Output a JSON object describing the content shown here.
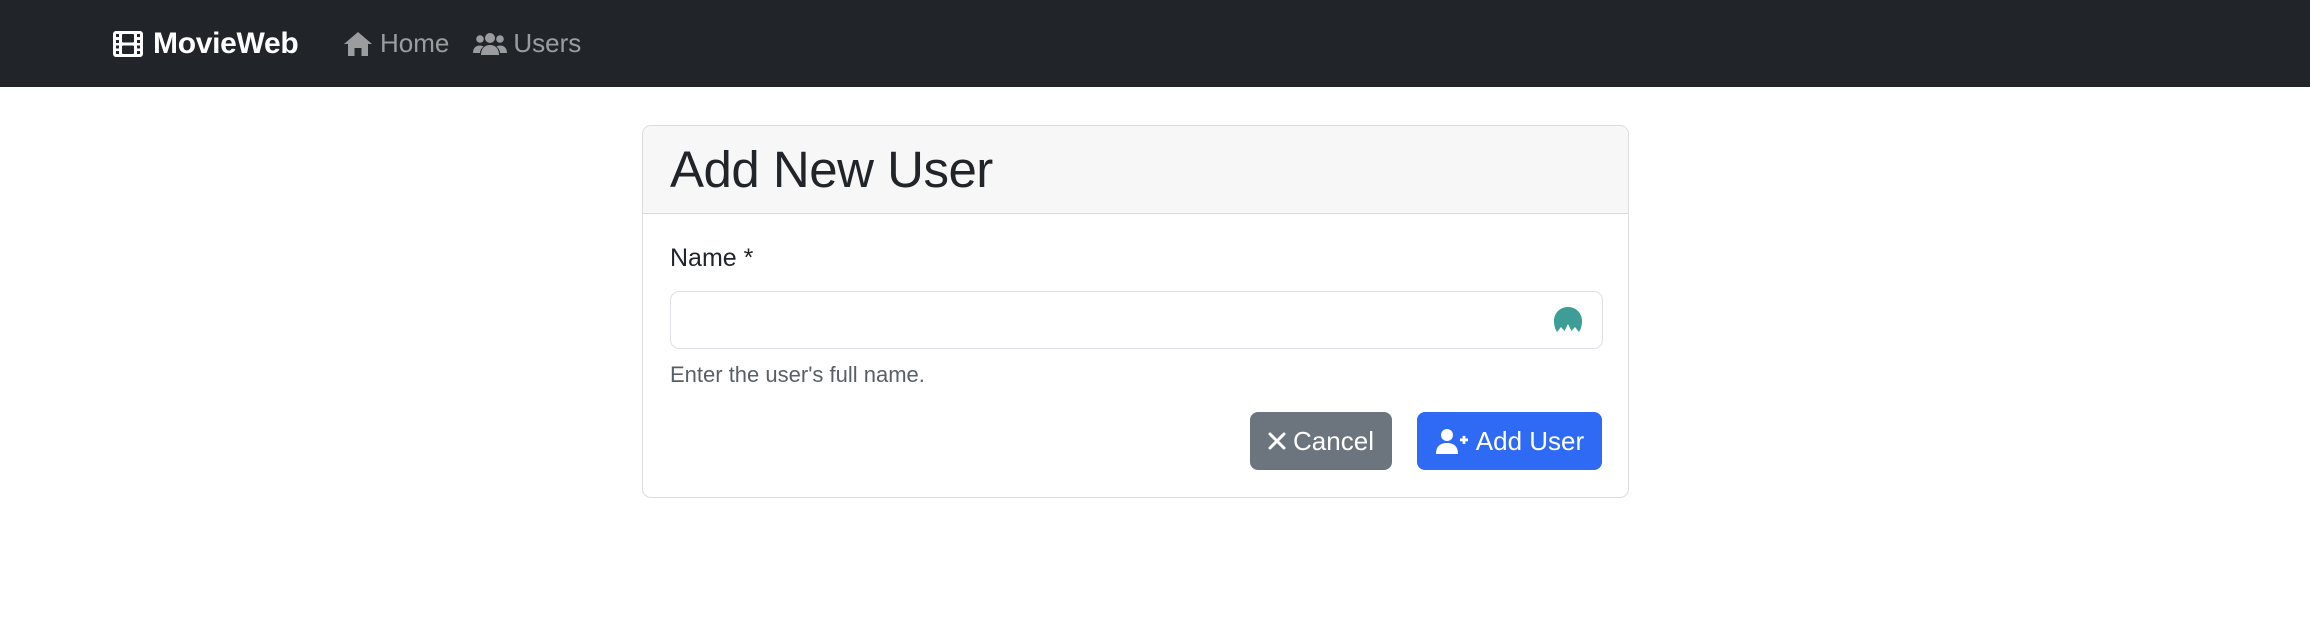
{
  "navbar": {
    "brand": "MovieWeb",
    "brand_icon": "film-icon",
    "links": [
      {
        "label": "Home",
        "icon": "home-icon"
      },
      {
        "label": "Users",
        "icon": "users-icon"
      }
    ],
    "background": "#212529"
  },
  "form": {
    "title": "Add New User",
    "name_label": "Name *",
    "name_value": "",
    "name_placeholder": "",
    "help_text": "Enter the user's full name.",
    "cancel_label": "Cancel",
    "cancel_icon": "close-icon",
    "submit_label": "Add User",
    "submit_icon": "user-plus-icon",
    "input_extension_icon": "password-manager-icon"
  },
  "colors": {
    "primary": "#2f6af5",
    "secondary": "#6c757d",
    "extension_icon": "#3e9e97"
  }
}
